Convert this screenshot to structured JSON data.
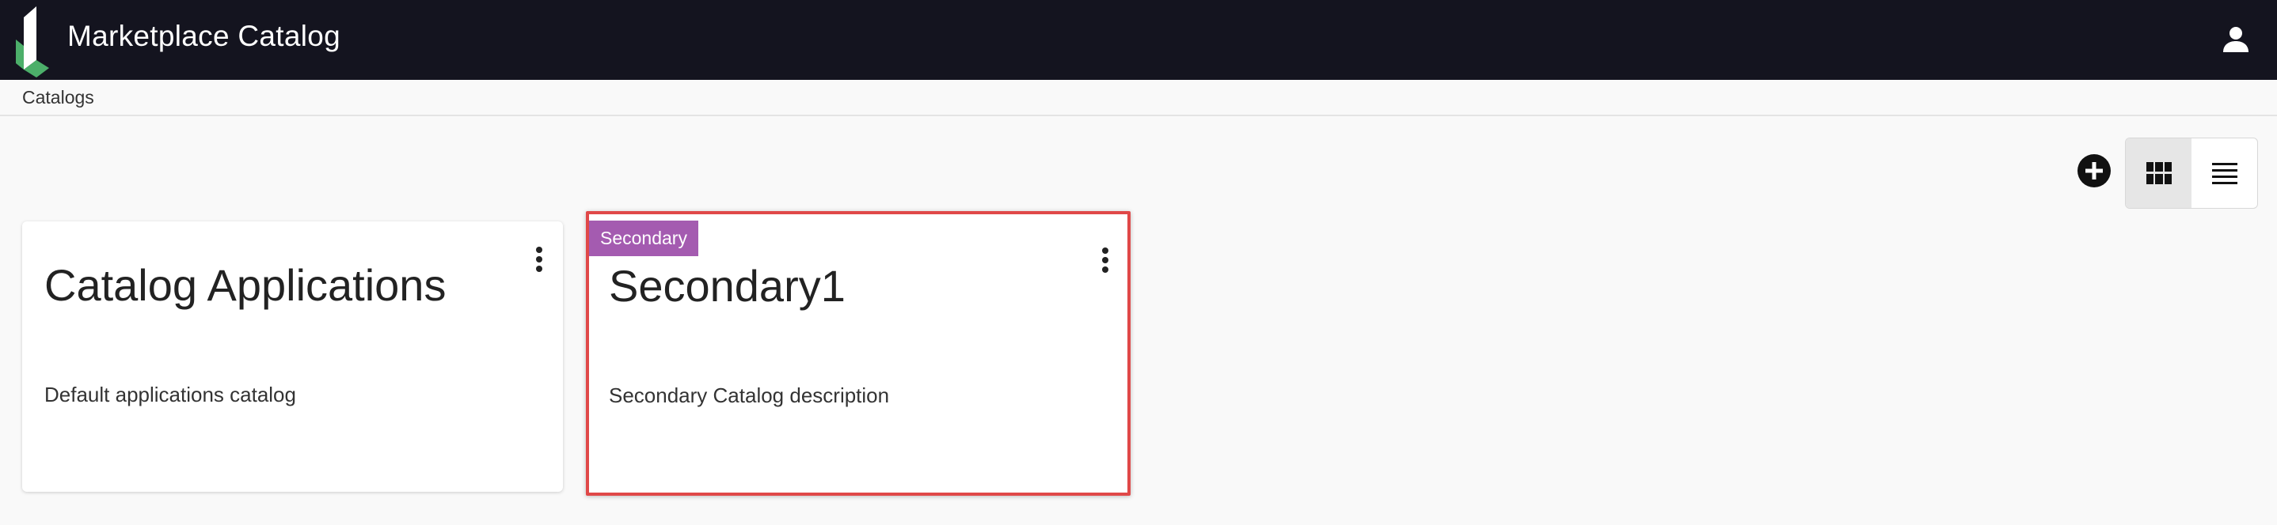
{
  "header": {
    "title": "Marketplace Catalog",
    "logo_icon": "brand-logo-icon",
    "user_icon": "user-icon",
    "colors": {
      "background": "#14141f",
      "logo_white": "#ffffff",
      "logo_green": "#4caf6a"
    }
  },
  "breadcrumb": {
    "items": [
      {
        "label": "Catalogs"
      }
    ]
  },
  "toolbar": {
    "add_icon": "plus-circle-icon",
    "views": [
      {
        "name": "grid",
        "icon": "grid-icon",
        "active": true
      },
      {
        "name": "list",
        "icon": "list-icon",
        "active": false
      }
    ]
  },
  "catalogs": [
    {
      "title": "Catalog Applications",
      "description": "Default applications catalog",
      "badge": null,
      "selected": false
    },
    {
      "title": "Secondary1",
      "description": "Secondary Catalog description",
      "badge": "Secondary",
      "selected": true
    }
  ],
  "colors": {
    "badge": "#a45bb0",
    "selection_outline": "#e04848",
    "page_background": "#f9f9f9"
  }
}
